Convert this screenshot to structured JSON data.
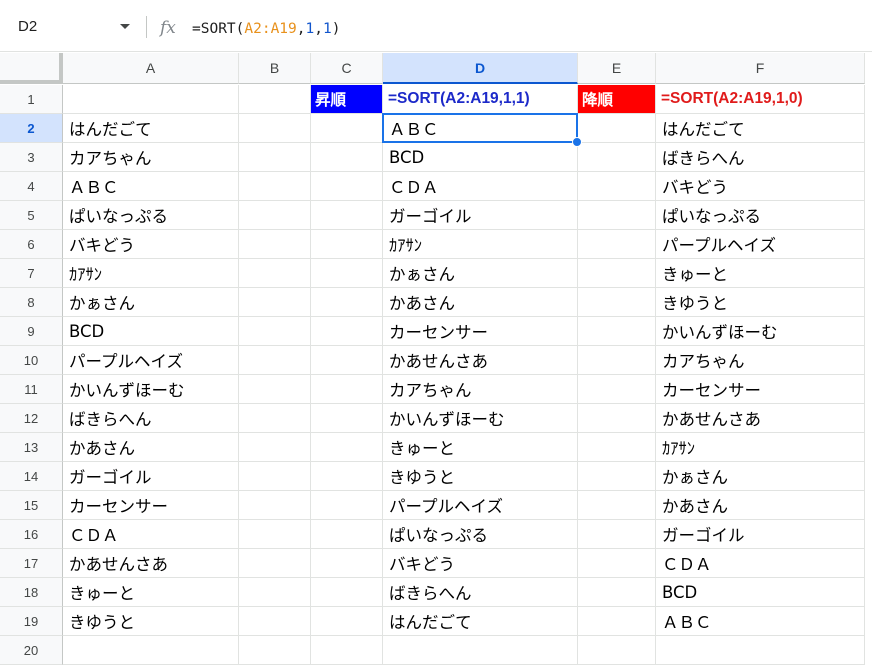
{
  "name_box": "D2",
  "formula_bar": {
    "fx_icon": "fx",
    "parts": [
      {
        "text": "=SORT(",
        "kind": "plain"
      },
      {
        "text": "A2:A19",
        "kind": "ref"
      },
      {
        "text": ",",
        "kind": "plain"
      },
      {
        "text": "1",
        "kind": "num"
      },
      {
        "text": ",",
        "kind": "plain"
      },
      {
        "text": "1",
        "kind": "num"
      },
      {
        "text": ")",
        "kind": "plain"
      }
    ]
  },
  "colors": {
    "header_blue": "#0000ff",
    "header_red": "#ff0000",
    "selection": "#1a73e8"
  },
  "columns": [
    "A",
    "B",
    "C",
    "D",
    "E",
    "F"
  ],
  "selected_column": "D",
  "rows": [
    "1",
    "2",
    "3",
    "4",
    "5",
    "6",
    "7",
    "8",
    "9",
    "10",
    "11",
    "12",
    "13",
    "14",
    "15",
    "16",
    "17",
    "18",
    "19",
    "20"
  ],
  "selected_row": "2",
  "headers": {
    "C1": "昇順",
    "D1": "=SORT(A2:A19,1,1)",
    "E1": "降順",
    "F1": "=SORT(A2:A19,1,0)"
  },
  "column_a": [
    "はんだごて",
    "カアちゃん",
    "ＡＢＣ",
    "ぱいなっぷる",
    "バキどう",
    "ｶｱｻﾝ",
    "かぁさん",
    "BCD",
    "パープルヘイズ",
    "かいんずほーむ",
    "ばきらへん",
    "かあさん",
    "ガーゴイル",
    "カーセンサー",
    "ＣＤＡ",
    "かあせんさあ",
    "きゅーと",
    "きゆうと"
  ],
  "column_d": [
    "ＡＢＣ",
    "BCD",
    "ＣＤＡ",
    "ガーゴイル",
    "ｶｱｻﾝ",
    "かぁさん",
    "かあさん",
    "カーセンサー",
    "かあせんさあ",
    "カアちゃん",
    "かいんずほーむ",
    "きゅーと",
    "きゆうと",
    "パープルヘイズ",
    "ぱいなっぷる",
    "バキどう",
    "ばきらへん",
    "はんだごて"
  ],
  "column_f": [
    "はんだごて",
    "ばきらへん",
    "バキどう",
    "ぱいなっぷる",
    "パープルヘイズ",
    "きゅーと",
    "きゆうと",
    "かいんずほーむ",
    "カアちゃん",
    "カーセンサー",
    "かあせんさあ",
    "ｶｱｻﾝ",
    "かぁさん",
    "かあさん",
    "ガーゴイル",
    "ＣＤＡ",
    "BCD",
    "ＡＢＣ"
  ]
}
